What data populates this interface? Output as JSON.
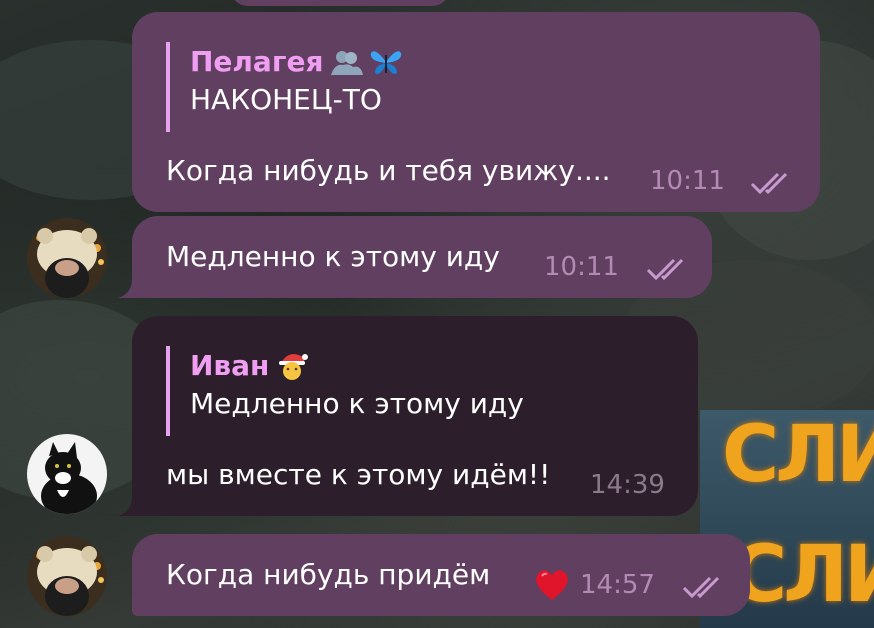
{
  "messages": [
    {
      "quote_name": "Пелагея",
      "quote_text": "НАКОНЕЦ-ТО",
      "text": "Когда нибудь и тебя увижу....",
      "time": "10:11"
    },
    {
      "text": "Медленно к этому иду",
      "time": "10:11"
    },
    {
      "quote_name": "Иван",
      "quote_text": "Медленно к этому иду",
      "text": "мы вместе к этому идём!!",
      "time": "14:39"
    },
    {
      "text": "Когда нибудь придём",
      "time": "14:57"
    }
  ],
  "background_sign": "СЛИ",
  "colors": {
    "outgoing_bubble": "#613f60",
    "incoming_bubble": "#2c1f2b",
    "quote_name": "#ef9ef2",
    "time": "#b38ab3"
  },
  "icons": {
    "quote1_emojis": [
      "people-silhouette-icon",
      "butterfly-icon"
    ],
    "quote2_emoji": "santa-face-icon",
    "reaction": "heart-icon",
    "read_status": "double-check-icon"
  }
}
